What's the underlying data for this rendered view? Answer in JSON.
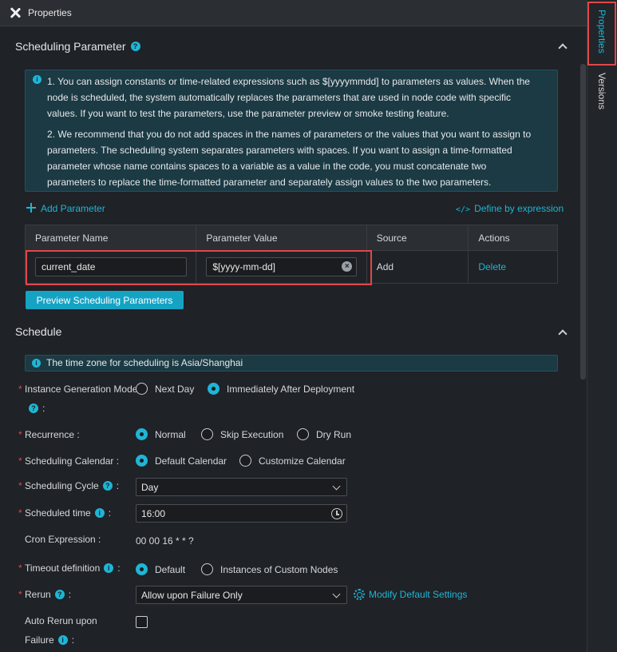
{
  "title": "Properties",
  "side_tabs": {
    "properties": "Properties",
    "versions": "Versions"
  },
  "scheduling_parameter": {
    "title": "Scheduling Parameter",
    "notice_p1": "1. You can assign constants or time-related expressions such as $[yyyymmdd] to parameters as values. When the node is scheduled, the system automatically replaces the parameters that are used in node code with specific values. If you want to test the parameters, use the parameter preview or smoke testing feature.",
    "notice_p2": "2. We recommend that you do not add spaces in the names of parameters or the values that you want to assign to parameters. The scheduling system separates parameters with spaces. If you want to assign a time-formatted parameter whose name contains spaces to a variable as a value in the code, you must concatenate two parameters to replace the time-formatted parameter and separately assign values to the two parameters.",
    "add_parameter": "Add Parameter",
    "define_expression": "Define by expression",
    "columns": [
      "Parameter Name",
      "Parameter Value",
      "Source",
      "Actions"
    ],
    "row": {
      "name": "current_date",
      "value": "$[yyyy-mm-dd]",
      "source": "Add",
      "action": "Delete"
    },
    "preview_button": "Preview Scheduling Parameters"
  },
  "schedule": {
    "title": "Schedule",
    "timezone": "The time zone for scheduling is Asia/Shanghai",
    "instance_generation": {
      "label": "Instance Generation Mode",
      "colon": ":",
      "options": [
        "Next Day",
        "Immediately After Deployment"
      ],
      "selected": "Immediately After Deployment"
    },
    "recurrence": {
      "label": "Recurrence :",
      "options": [
        "Normal",
        "Skip Execution",
        "Dry Run"
      ],
      "selected": "Normal"
    },
    "calendar": {
      "label": "Scheduling Calendar :",
      "options": [
        "Default Calendar",
        "Customize Calendar"
      ],
      "selected": "Default Calendar"
    },
    "cycle": {
      "label": "Scheduling Cycle",
      "colon": ":",
      "value": "Day"
    },
    "time": {
      "label": "Scheduled time",
      "colon": ":",
      "value": "16:00"
    },
    "cron": {
      "label": "Cron Expression :",
      "value": "00 00 16 * * ?"
    },
    "timeout": {
      "label": "Timeout definition",
      "colon": ":",
      "options": [
        "Default",
        "Instances of Custom Nodes"
      ],
      "selected": "Default"
    },
    "rerun": {
      "label": "Rerun",
      "colon": ":",
      "value": "Allow upon Failure Only",
      "modify": "Modify Default Settings"
    },
    "auto_rerun": {
      "label_line1": "Auto Rerun upon",
      "label_line2": "Failure",
      "colon": ":"
    }
  }
}
